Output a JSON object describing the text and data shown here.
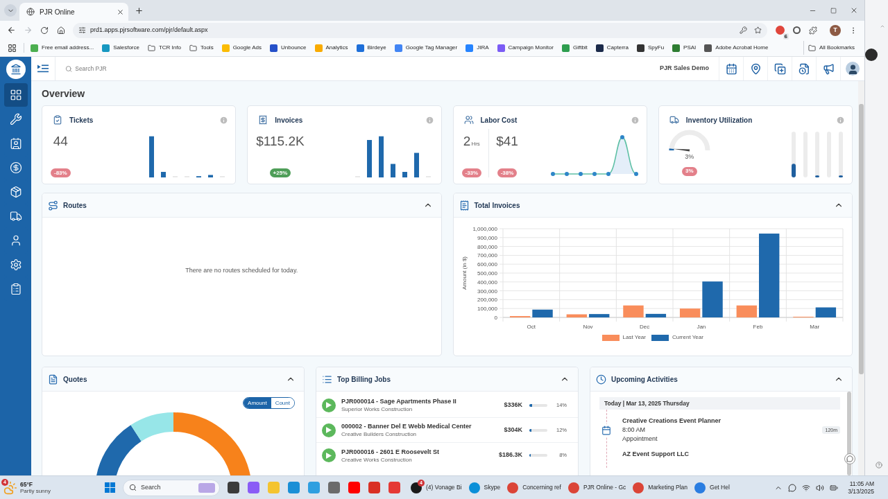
{
  "browser": {
    "tabs": [
      {
        "title": "PJR Online",
        "selected": true
      }
    ],
    "forward": {
      "disabled": true
    },
    "url": "prd1.apps.pjrsoftware.com/pjr/default.aspx",
    "extension_badge": "6",
    "profile_initial": "T",
    "bookmarks": [
      {
        "label": "Free email address...",
        "kind": "site",
        "color": "#4caf50"
      },
      {
        "label": "Salesforce",
        "kind": "site",
        "color": "#1798c1"
      },
      {
        "label": "TCR Info",
        "kind": "folder"
      },
      {
        "label": "Tools",
        "kind": "folder"
      },
      {
        "label": "Google Ads",
        "kind": "site",
        "color": "#fbbc04"
      },
      {
        "label": "Unbounce",
        "kind": "site",
        "color": "#2550c9"
      },
      {
        "label": "Analytics",
        "kind": "site",
        "color": "#f9ab00"
      },
      {
        "label": "Birdeye",
        "kind": "site",
        "color": "#1e6fd9"
      },
      {
        "label": "Google Tag Manager",
        "kind": "site",
        "color": "#4285f4"
      },
      {
        "label": "JIRA",
        "kind": "site",
        "color": "#2684ff"
      },
      {
        "label": "Campaign Monitor",
        "kind": "site",
        "color": "#7b5cf5"
      },
      {
        "label": "Giftbit",
        "kind": "site",
        "color": "#2e9e4f"
      },
      {
        "label": "Capterra",
        "kind": "site",
        "color": "#1b2a4a"
      },
      {
        "label": "SpyFu",
        "kind": "site",
        "color": "#333333"
      },
      {
        "label": "PSAI",
        "kind": "site",
        "color": "#2e7d32"
      },
      {
        "label": "Adobe Acrobat Home",
        "kind": "site",
        "color": "#555555"
      }
    ],
    "all_bookmarks": "All Bookmarks"
  },
  "app": {
    "header": {
      "search": {
        "placeholder": "Search PJR"
      },
      "account": "PJR Sales Demo"
    },
    "sidebar": {
      "items": [
        {
          "selected": true
        },
        {
          "selected": false
        },
        {
          "selected": false
        },
        {
          "selected": false
        },
        {
          "selected": false
        },
        {
          "selected": false
        },
        {
          "selected": false
        },
        {
          "selected": false
        },
        {
          "selected": false
        }
      ]
    },
    "page_title": "Overview",
    "kpi_cards": [
      {
        "kind": "bars",
        "title": "Tickets",
        "metrics": [
          {
            "value": "44",
            "change": {
              "text": "-83%",
              "color": "#e3808a"
            }
          }
        ]
      },
      {
        "kind": "bars",
        "title": "Invoices",
        "metrics": [
          {
            "value": "$115.2K",
            "change": {
              "text": "+25%",
              "color": "#4e9e58"
            }
          }
        ]
      },
      {
        "kind": "line",
        "title": "Labor Cost",
        "metrics": [
          {
            "value": "2",
            "unit": "Hrs",
            "change": {
              "text": "-33%",
              "color": "#e3808a"
            }
          },
          {
            "value": "$41",
            "change": {
              "text": "-38%",
              "color": "#e3808a"
            }
          }
        ]
      },
      {
        "kind": "gauge",
        "title": "Inventory Utilization",
        "gauge": {
          "level": 0.03,
          "reading": "3%"
        },
        "change": {
          "text": "3%",
          "color": "#e3808a"
        }
      }
    ],
    "routes": {
      "title": "Routes",
      "expanded": true,
      "message": "There are no routes scheduled for today."
    },
    "total_invoices": {
      "title": "Total Invoices",
      "expanded": true,
      "chart_data": {
        "type": "bar",
        "ylabel": "Amount (in $)",
        "categories": [
          "Oct",
          "Nov",
          "Dec",
          "Jan",
          "Feb",
          "Mar"
        ],
        "series": [
          {
            "name": "Last Year",
            "color": "#f98d5b",
            "values": [
              15000,
              35000,
              135000,
              100000,
              135000,
              3000
            ]
          },
          {
            "name": "Current Year",
            "color": "#1f69ac",
            "values": [
              88000,
              38000,
              40000,
              405000,
              945000,
              113000
            ]
          }
        ],
        "ylim": [
          0,
          1000000
        ],
        "yticks": [
          {
            "value": 0,
            "label": "0"
          },
          {
            "value": 100000,
            "label": "100,000"
          },
          {
            "value": 200000,
            "label": "200,000"
          },
          {
            "value": 300000,
            "label": "300,000"
          },
          {
            "value": 400000,
            "label": "400,000"
          },
          {
            "value": 500000,
            "label": "500,000"
          },
          {
            "value": 600000,
            "label": "600,000"
          },
          {
            "value": 700000,
            "label": "700,000"
          },
          {
            "value": 800000,
            "label": "800,000"
          },
          {
            "value": 900000,
            "label": "900,000"
          },
          {
            "value": 1000000,
            "label": "1,000,000"
          }
        ],
        "grid": true,
        "legend": "bottom"
      }
    },
    "quotes": {
      "title": "Quotes",
      "expanded": true,
      "toggle": [
        {
          "label": "Amount",
          "selected": true
        },
        {
          "label": "Count",
          "selected": false
        }
      ]
    },
    "top_billing_jobs": {
      "title": "Top Billing Jobs",
      "expanded": true,
      "rows": [
        {
          "title": "PJR000014 - Sage Apartments Phase II",
          "customer": "Superior Works Construction",
          "amount": "$336K",
          "level": 0.14,
          "percent": "14%"
        },
        {
          "title": "000002 - Banner Del E Webb Medical Center",
          "customer": "Creative Builders Construction",
          "amount": "$304K",
          "level": 0.12,
          "percent": "12%"
        },
        {
          "title": "PJR000016 - 2601 E Roosevelt St",
          "customer": "Creative Works Construction",
          "amount": "$186.3K",
          "level": 0.08,
          "percent": "8%"
        }
      ]
    },
    "upcoming_activities": {
      "title": "Upcoming Activities",
      "expanded": true,
      "day": "Today | Mar 13, 2025 Thursday",
      "events": [
        {
          "title": "Creative Creations Event Planner",
          "time": "8:00 AM",
          "type": "Appointment",
          "duration": "120m"
        },
        {
          "title": "AZ Event Support LLC"
        }
      ]
    }
  },
  "taskbar": {
    "weather": {
      "badge": "4",
      "temperature": "65°F",
      "condition": "Partly sunny"
    },
    "search": {
      "placeholder": "Search"
    },
    "pinned": [
      {
        "color": "#3b3b3b"
      },
      {
        "color": "#8a5cf6"
      },
      {
        "color": "#f4c430"
      },
      {
        "color": "#1a8fd6"
      },
      {
        "color": "#2f9fe0"
      },
      {
        "color": "#6b6b6b"
      },
      {
        "color": "#ff0000"
      },
      {
        "color": "#d93025"
      },
      {
        "color": "#e53935"
      }
    ],
    "windows": [
      {
        "label": "(4) Vonage Bi",
        "color": "#1a1a1a",
        "badge": "4"
      },
      {
        "label": "Skype",
        "color": "#0a8fd8"
      },
      {
        "label": "Concerning ref",
        "color": "#db4437"
      },
      {
        "label": "PJR Online - Gc",
        "color": "#db4437"
      },
      {
        "label": "Marketing Plan",
        "color": "#db4437"
      },
      {
        "label": "Get Hel",
        "color": "#2a7de1"
      }
    ],
    "clock": {
      "time": "11:05 AM",
      "date": "3/13/2025"
    }
  }
}
